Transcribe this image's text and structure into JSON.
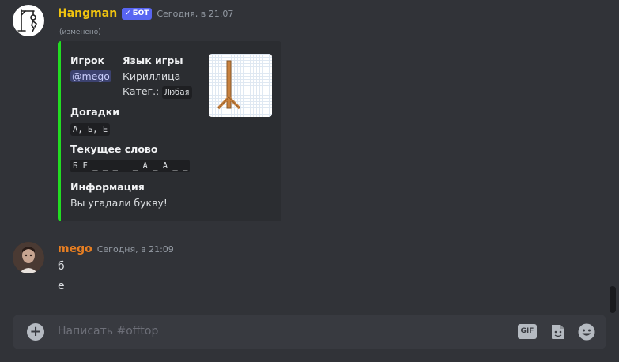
{
  "bot_message": {
    "username": "Hangman",
    "badge": "БОТ",
    "timestamp": "Сегодня, в 21:07",
    "edited": "(изменено)",
    "embed": {
      "fields": {
        "player_label": "Игрок",
        "player_value": "@mego",
        "language_label": "Язык игры",
        "language_value": "Кириллица",
        "category_label": "Катег.:",
        "category_value": "Любая",
        "guesses_label": "Догадки",
        "guesses_value": "А, Б, Е",
        "word_label": "Текущее слово",
        "word_value": "Б Е _ _ _   _ А _ А _ _",
        "info_label": "Информация",
        "info_value": "Вы угадали букву!"
      },
      "accent_color": "#22dd22"
    }
  },
  "user_message": {
    "username": "mego",
    "timestamp": "Сегодня, в 21:09",
    "lines": [
      "б",
      "е"
    ],
    "name_color": "#e67e22"
  },
  "composer": {
    "placeholder": "Написать #offtop",
    "gif_label": "GIF"
  },
  "colors": {
    "bot_name": "#f1c40f",
    "badge": "#5865f2",
    "background": "#313338"
  }
}
